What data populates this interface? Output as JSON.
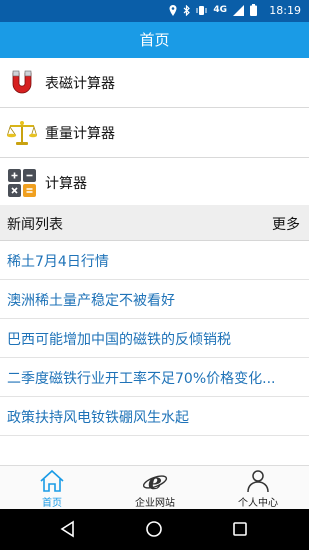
{
  "status_bar": {
    "network": "4G",
    "time": "18:19"
  },
  "header": {
    "title": "首页"
  },
  "tools": [
    {
      "label": "表磁计算器",
      "icon": "magnet-icon"
    },
    {
      "label": "重量计算器",
      "icon": "scale-icon"
    },
    {
      "label": "计算器",
      "icon": "calculator-icon"
    }
  ],
  "news": {
    "title": "新闻列表",
    "more": "更多",
    "items": [
      "稀土7月4日行情",
      "澳洲稀土量产稳定不被看好",
      "巴西可能增加中国的磁铁的反倾销税",
      "二季度磁铁行业开工率不足70%价格变化...",
      "政策扶持风电钕铁硼风生水起"
    ]
  },
  "tabs": [
    {
      "label": "首页",
      "icon": "home-icon",
      "active": true
    },
    {
      "label": "企业网站",
      "icon": "browser-icon",
      "active": false
    },
    {
      "label": "个人中心",
      "icon": "person-icon",
      "active": false
    }
  ],
  "colors": {
    "header": "#1a9be6",
    "status_bar": "#0a5ea8",
    "link": "#1f73b8"
  }
}
